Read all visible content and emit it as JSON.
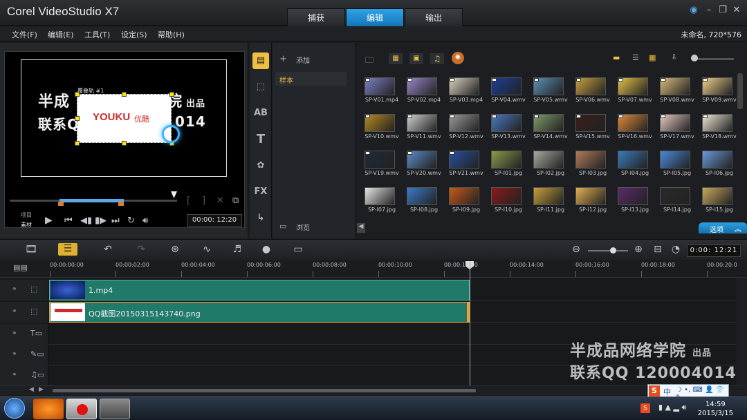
{
  "app": {
    "title": "Corel VideoStudio X7"
  },
  "mode_tabs": [
    {
      "label": "捕获"
    },
    {
      "label": "编辑"
    },
    {
      "label": "输出"
    }
  ],
  "menu": [
    {
      "label": "文件(F)"
    },
    {
      "label": "编辑(E)"
    },
    {
      "label": "工具(T)"
    },
    {
      "label": "设定(S)"
    },
    {
      "label": "帮助(H)"
    }
  ],
  "project_info": "未命名, 720*576",
  "preview": {
    "track_label": "覆叠轨 #1",
    "watermark_line1": "半成",
    "watermark_line1_end": "院",
    "watermark_suffix": "出品",
    "watermark_line2": "联系Q",
    "watermark_line2_end": "014",
    "youku_text": "YOUKU",
    "youku_cn": "优酷",
    "mode_project": "项目",
    "mode_clip": "素材",
    "timecode": "00:00: 12:20"
  },
  "folder_panel": {
    "add_label": "添加",
    "folders": [
      "样本"
    ],
    "browse_label": "浏览"
  },
  "library": {
    "options_label": "选项",
    "thumbs": [
      {
        "cap": "SP-V01.mp4",
        "color": "#7d7fc7"
      },
      {
        "cap": "SP-V02.mp4",
        "color": "#9a86c8"
      },
      {
        "cap": "SP-V03.mp4",
        "color": "#d8d2bd"
      },
      {
        "cap": "SP-V04.wmv",
        "color": "#1d3f9a"
      },
      {
        "cap": "SP-V05.wmv",
        "color": "#5c8fb5"
      },
      {
        "cap": "SP-V06.wmv",
        "color": "#c7a042"
      },
      {
        "cap": "SP-V07.wmv",
        "color": "#e2c24a"
      },
      {
        "cap": "SP-V08.wmv",
        "color": "#d9bb7b"
      },
      {
        "cap": "SP-V09.wmv",
        "color": "#f0cf8a"
      },
      {
        "cap": "SP-V10.wmv",
        "color": "#b58a22"
      },
      {
        "cap": "SP-V11.wmv",
        "color": "#d0d0d0"
      },
      {
        "cap": "SP-V12.wmv",
        "color": "#9a9a9a"
      },
      {
        "cap": "SP-V13.wmv",
        "color": "#4a78c0"
      },
      {
        "cap": "SP-V14.wmv",
        "color": "#7e9a6a"
      },
      {
        "cap": "SP-V15.wmv",
        "color": "#3a1d1d"
      },
      {
        "cap": "SP-V16.wmv",
        "color": "#e08a3a"
      },
      {
        "cap": "SP-V17.wmv",
        "color": "#e9c9c0"
      },
      {
        "cap": "SP-V18.wmv",
        "color": "#efe7d4"
      },
      {
        "cap": "SP-V19.wmv",
        "color": "#1f2a3a"
      },
      {
        "cap": "SP-V20.wmv",
        "color": "#5a8bc2"
      },
      {
        "cap": "SP-V21.wmv",
        "color": "#2750a0"
      },
      {
        "cap": "SP-I01.jpg",
        "color": "#8a9a4a"
      },
      {
        "cap": "SP-I02.jpg",
        "color": "#a8a8a0"
      },
      {
        "cap": "SP-I03.jpg",
        "color": "#b07a5a"
      },
      {
        "cap": "SP-I04.jpg",
        "color": "#3a7ab8"
      },
      {
        "cap": "SP-I05.jpg",
        "color": "#4a8ad8"
      },
      {
        "cap": "SP-I06.jpg",
        "color": "#6a9ad8"
      },
      {
        "cap": "SP-I07.jpg",
        "color": "#e6e6e6"
      },
      {
        "cap": "SP-I08.jpg",
        "color": "#3a7ac8"
      },
      {
        "cap": "SP-I09.jpg",
        "color": "#c85a1a"
      },
      {
        "cap": "SP-I10.jpg",
        "color": "#8a1a1a"
      },
      {
        "cap": "SP-I11.jpg",
        "color": "#c8a03a"
      },
      {
        "cap": "SP-I12.jpg",
        "color": "#e0b050"
      },
      {
        "cap": "SP-I13.jpg",
        "color": "#5a2a6a"
      },
      {
        "cap": "SP-I14.jpg",
        "color": "#2a2a2a"
      },
      {
        "cap": "SP-I15.jpg",
        "color": "#c8a860"
      }
    ]
  },
  "timeline": {
    "timecode": "0:00: 12:21",
    "ruler": [
      "00:00:00:00",
      "00:00:02:00",
      "00:00:04:00",
      "00:00:06:00",
      "00:00:08:00",
      "00:00:10:00",
      "00:00:12:00",
      "00:00:14:00",
      "00:00:16:00",
      "00:00:18:00",
      "00:00:20:0"
    ],
    "clips": [
      {
        "label": "1.mp4"
      },
      {
        "label": "QQ截图20150315143740.png"
      }
    ]
  },
  "watermark": {
    "line1": "半成品网络学院",
    "line1_suffix": "出品",
    "line2": "联系QQ 120004014"
  },
  "taskbar": {
    "time": "14:59",
    "date": "2015/3/15",
    "ime": "中"
  }
}
